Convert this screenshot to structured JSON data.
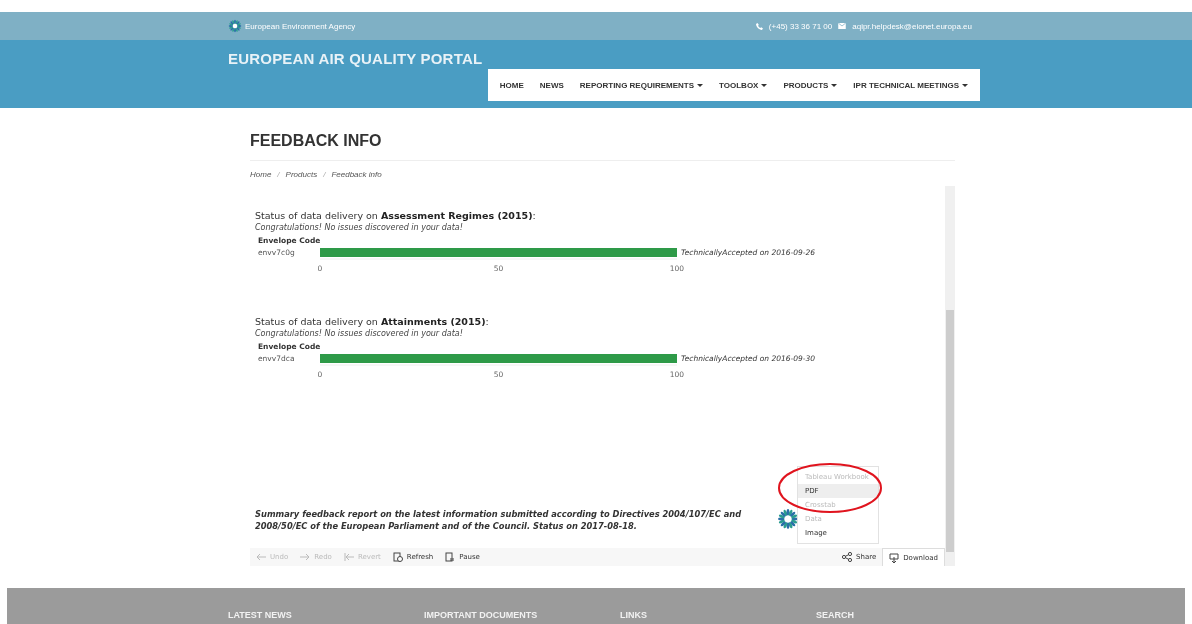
{
  "topbar": {
    "agency": "European Environment Agency",
    "phone": "(+45) 33 36 71 00",
    "email": "aqipr.helpdesk@eionet.europa.eu"
  },
  "header": {
    "title": "EUROPEAN AIR QUALITY PORTAL",
    "nav": [
      {
        "label": "HOME",
        "dropdown": false
      },
      {
        "label": "NEWS",
        "dropdown": false
      },
      {
        "label": "REPORTING REQUIREMENTS",
        "dropdown": true
      },
      {
        "label": "TOOLBOX",
        "dropdown": true
      },
      {
        "label": "PRODUCTS",
        "dropdown": true
      },
      {
        "label": "IPR TECHNICAL MEETINGS",
        "dropdown": true
      }
    ]
  },
  "page": {
    "title": "FEEDBACK INFO",
    "breadcrumb": [
      "Home",
      "Products",
      "Feedback info"
    ],
    "breadcrumb_separator": "/"
  },
  "viz": {
    "sections": [
      {
        "title": "Status of data delivery on **Assessment Regimes (2015)**:",
        "message": "Congratulations! No issues discovered in your data!",
        "chart_data": {
          "type": "bar",
          "orientation": "horizontal",
          "ylabel": "Envelope Code",
          "categories": [
            "envv7c0g"
          ],
          "values": [
            100
          ],
          "xlim": [
            0,
            100
          ],
          "xticks": [
            0,
            50,
            100
          ],
          "annotations": [
            {
              "x": 100,
              "text": "TechnicallyAccepted on 2016-09-26"
            }
          ]
        }
      },
      {
        "title": "Status of data delivery on **Attainments (2015)**:",
        "message": "Congratulations! No issues discovered in your data!",
        "chart_data": {
          "type": "bar",
          "orientation": "horizontal",
          "ylabel": "Envelope Code",
          "categories": [
            "envv7dca"
          ],
          "values": [
            100
          ],
          "xlim": [
            0,
            100
          ],
          "xticks": [
            0,
            50,
            100
          ],
          "annotations": [
            {
              "x": 100,
              "text": "TechnicallyAccepted on 2016-09-30"
            }
          ]
        }
      }
    ],
    "summary": "Summary feedback report on the latest information submitted according to Directives 2004/107/EC and 2008/50/EC of the European Parliament and of the Council. Status on 2017-08-18.",
    "download_menu": [
      {
        "label": "Tableau Workbook",
        "disabled": true,
        "selected": false
      },
      {
        "label": "PDF",
        "disabled": false,
        "selected": true
      },
      {
        "label": "Crosstab",
        "disabled": true,
        "selected": false
      },
      {
        "label": "Data",
        "disabled": true,
        "selected": false
      },
      {
        "label": "Image",
        "disabled": false,
        "selected": false
      }
    ],
    "toolbar_left": [
      {
        "kind": "undo",
        "label": "Undo",
        "disabled": true
      },
      {
        "kind": "redo",
        "label": "Redo",
        "disabled": true
      },
      {
        "kind": "revert",
        "label": "Revert",
        "disabled": true
      },
      {
        "kind": "refresh",
        "label": "Refresh",
        "disabled": false
      },
      {
        "kind": "pause",
        "label": "Pause",
        "disabled": false
      }
    ],
    "toolbar_right": [
      {
        "kind": "share",
        "label": "Share"
      },
      {
        "kind": "download",
        "label": "Download"
      }
    ]
  },
  "footer": {
    "headings": [
      "LATEST NEWS",
      "IMPORTANT DOCUMENTS",
      "LINKS",
      "SEARCH"
    ]
  }
}
